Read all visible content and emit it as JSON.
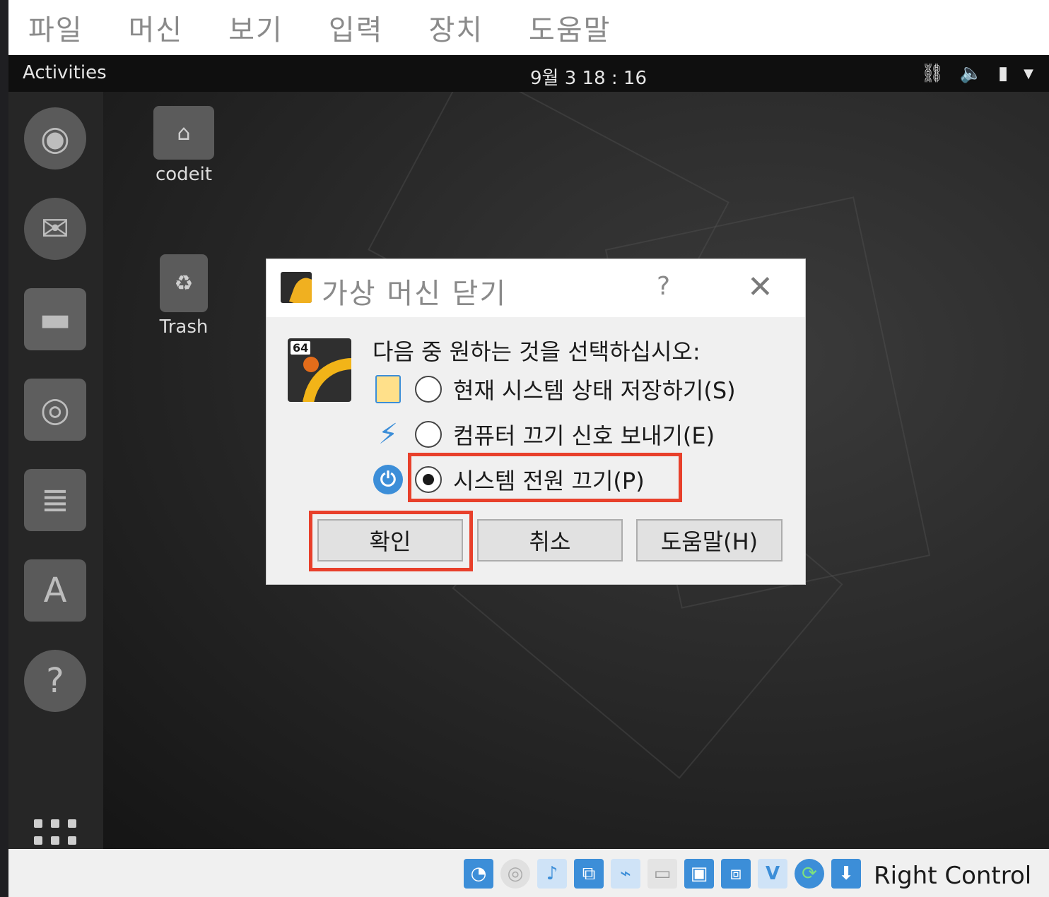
{
  "vbox_menu": [
    "파일",
    "머신",
    "보기",
    "입력",
    "장치",
    "도움말"
  ],
  "topbar": {
    "activities": "Activities",
    "clock": "9월 3  18 : 16"
  },
  "desktop": {
    "items": [
      {
        "label": "codeit"
      },
      {
        "label": "Trash"
      }
    ]
  },
  "dialog": {
    "title": "가상 머신 닫기",
    "help_glyph": "?",
    "close_glyph": "✕",
    "logo_badge": "64",
    "prompt": "다음 중 원하는 것을 선택하십시오:",
    "options": [
      {
        "label": "현재 시스템 상태 저장하기(S)",
        "checked": false
      },
      {
        "label": "컴퓨터 끄기 신호 보내기(E)",
        "checked": false
      },
      {
        "label": "시스템 전원 끄기(P)",
        "checked": true
      }
    ],
    "buttons": {
      "ok": "확인",
      "cancel": "취소",
      "help": "도움말(H)"
    },
    "highlight_color": "#e8402b"
  },
  "statusbar": {
    "host_key": "Right Control"
  }
}
